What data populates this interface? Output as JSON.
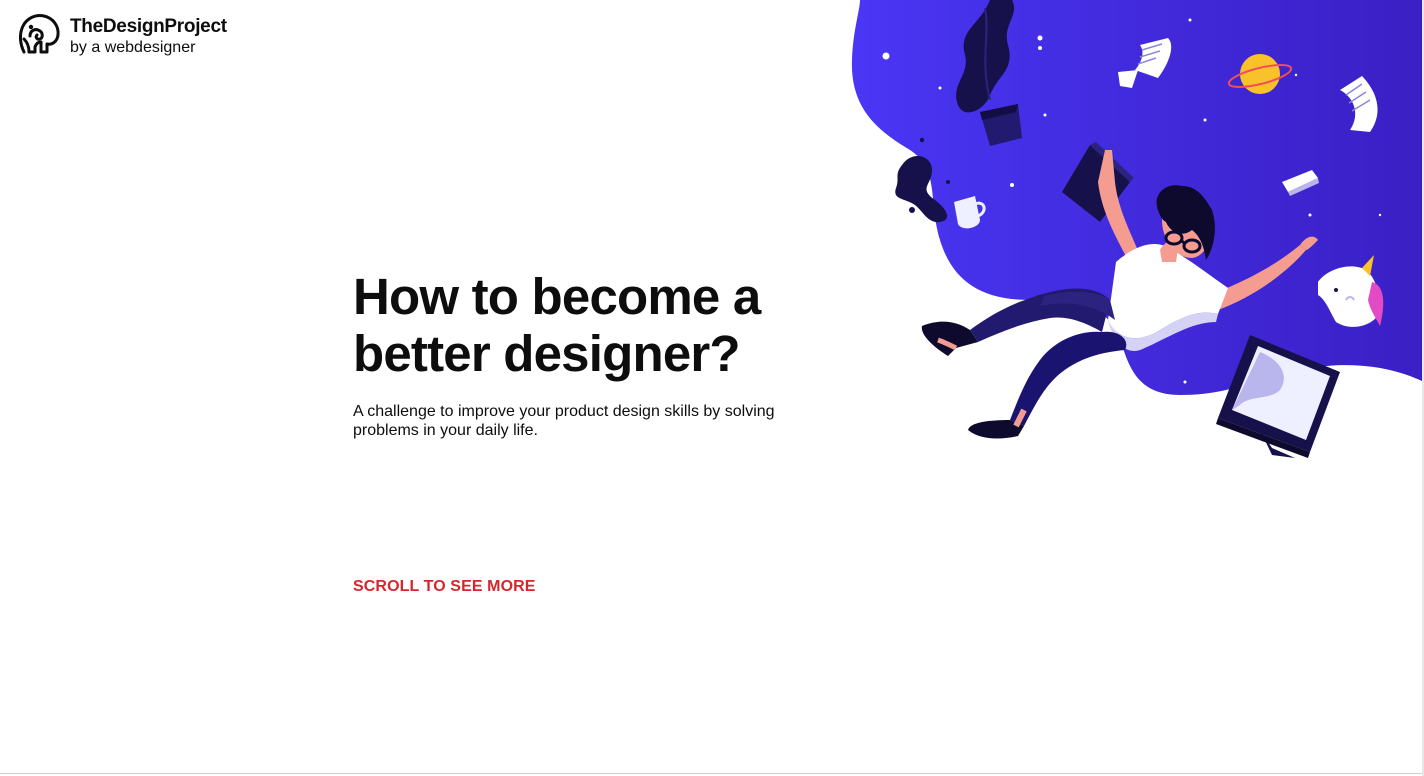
{
  "brand": {
    "name": "TheDesignProject",
    "tagline": "by a webdesigner",
    "logo_icon": "elephant-head-icon"
  },
  "hero": {
    "title": "How to become a better designer?",
    "subtitle": "A challenge to improve your product design skills by solving problems in your daily life.",
    "cta_label": "SCROLL TO SEE MORE"
  },
  "illustration": {
    "subject": "falling-designer-illustration",
    "elements": [
      "plant-icon",
      "paper-icon",
      "planet-icon",
      "coffee-cup-icon",
      "laptop-icon",
      "designer-character",
      "unicorn-icon",
      "monitor-icon",
      "pencil-icon"
    ]
  },
  "colors": {
    "accent": "#d6262d",
    "illustration_blob": "#4530f0",
    "illustration_dark": "#1a1470",
    "text": "#0d0d0d"
  }
}
